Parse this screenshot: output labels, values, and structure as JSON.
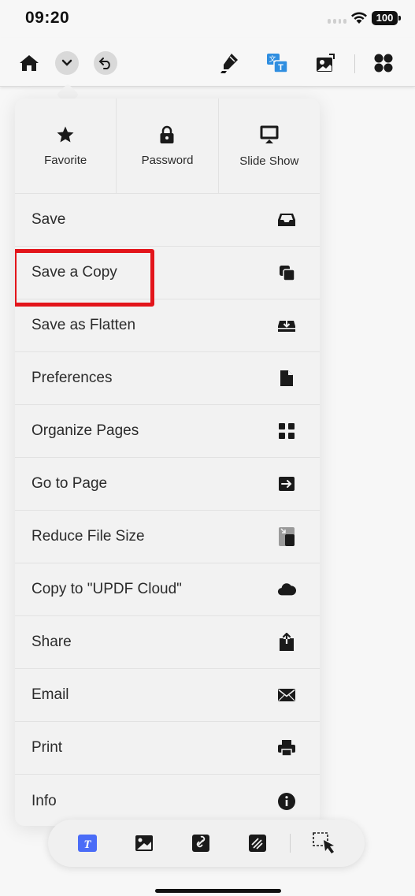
{
  "status_bar": {
    "time": "09:20",
    "battery": "100"
  },
  "toolbar": {
    "icons": [
      "home-icon",
      "chevron-down-icon",
      "undo-icon",
      "highlighter-icon",
      "translate-icon",
      "image-edit-icon",
      "grid-apps-icon"
    ]
  },
  "quick_actions": [
    {
      "label": "Favorite",
      "icon": "star-icon"
    },
    {
      "label": "Password",
      "icon": "lock-icon"
    },
    {
      "label": "Slide Show",
      "icon": "slideshow-icon"
    }
  ],
  "menu_items": [
    {
      "label": "Save",
      "icon": "tray-icon"
    },
    {
      "label": "Save a Copy",
      "icon": "copy-icon",
      "highlighted": true
    },
    {
      "label": "Save as Flatten",
      "icon": "flatten-download-icon"
    },
    {
      "label": "Preferences",
      "icon": "document-icon"
    },
    {
      "label": "Organize Pages",
      "icon": "grid-icon"
    },
    {
      "label": "Go to Page",
      "icon": "go-arrow-icon"
    },
    {
      "label": "Reduce File Size",
      "icon": "compress-icon"
    },
    {
      "label": "Copy to \"UPDF Cloud\"",
      "icon": "cloud-icon"
    },
    {
      "label": "Share",
      "icon": "share-icon"
    },
    {
      "label": "Email",
      "icon": "envelope-icon"
    },
    {
      "label": "Print",
      "icon": "printer-icon"
    },
    {
      "label": "Info",
      "icon": "info-icon"
    }
  ],
  "bottom_toolbar": {
    "icons": [
      "text-edit-icon",
      "image-icon",
      "link-icon",
      "redact-icon",
      "select-area-icon"
    ]
  },
  "colors": {
    "highlight": "#e3151b",
    "accent": "#4a6cf7",
    "translate": "#2f8ee0"
  }
}
